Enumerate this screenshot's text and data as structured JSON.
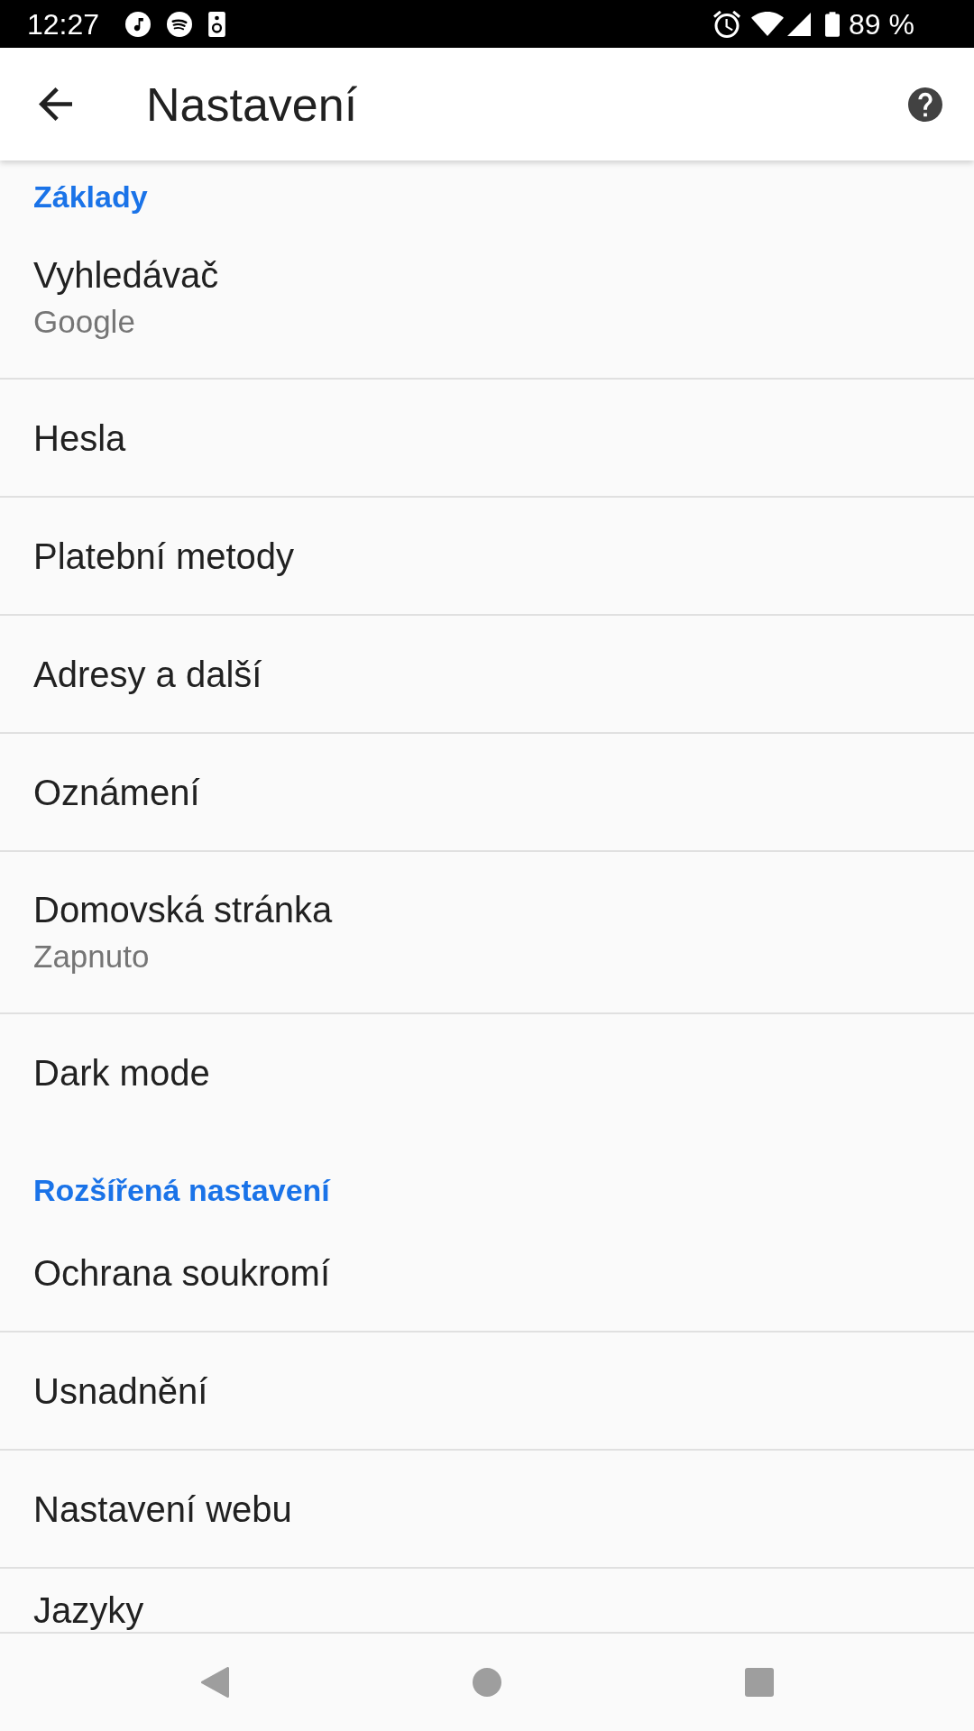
{
  "status_bar": {
    "time": "12:27",
    "battery": "89 %"
  },
  "app_bar": {
    "title": "Nastavení"
  },
  "sections": [
    {
      "header": "Základy",
      "items": [
        {
          "title": "Vyhledávač",
          "subtitle": "Google"
        },
        {
          "title": "Hesla"
        },
        {
          "title": "Platební metody"
        },
        {
          "title": "Adresy a další"
        },
        {
          "title": "Oznámení"
        },
        {
          "title": "Domovská stránka",
          "subtitle": "Zapnuto"
        },
        {
          "title": "Dark mode"
        }
      ]
    },
    {
      "header": "Rozšířená nastavení",
      "items": [
        {
          "title": "Ochrana soukromí"
        },
        {
          "title": "Usnadnění"
        },
        {
          "title": "Nastavení webu"
        },
        {
          "title": "Jazyky"
        }
      ]
    }
  ]
}
